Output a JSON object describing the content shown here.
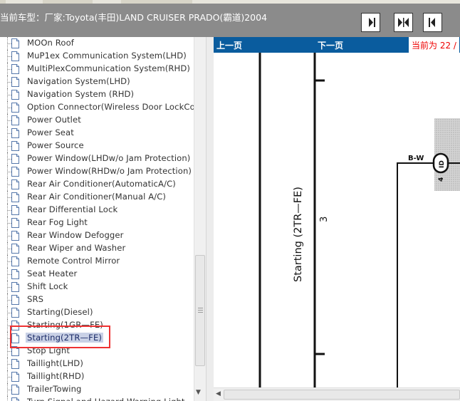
{
  "header": {
    "title": "当前车型：厂家:Toyota(丰田)LAND CRUISER PRADO(霸道)2004"
  },
  "nav_buttons": [
    {
      "name": "first-page",
      "icon": "skip-to-end-icon"
    },
    {
      "name": "dual-page",
      "icon": "two-page-icon"
    },
    {
      "name": "prev-page",
      "icon": "skip-back-icon"
    }
  ],
  "sidebar": {
    "items": [
      {
        "label": "MOOn Roof"
      },
      {
        "label": "MuP1ex Communication System(LHD)"
      },
      {
        "label": "MuItiPlexCommunication System(RHD)"
      },
      {
        "label": "Navigation System(LHD)"
      },
      {
        "label": "Navigation System (RHD)"
      },
      {
        "label": "Option Connector(Wireless Door LockCon"
      },
      {
        "label": "Power Outlet"
      },
      {
        "label": "Power Seat"
      },
      {
        "label": "Power Source"
      },
      {
        "label": "Power Window(LHDw/o Jam Protection)"
      },
      {
        "label": "Power Window(RHDw/o Jam Protection)"
      },
      {
        "label": "Rear Air Conditioner(AutomaticA/C)"
      },
      {
        "label": "Rear Air Conditioner(Manual A/C)"
      },
      {
        "label": "Rear DifferentiaI Lock"
      },
      {
        "label": "Rear Fog Light"
      },
      {
        "label": "Rear Window Defogger"
      },
      {
        "label": "Rear Wiper and Washer"
      },
      {
        "label": "Remote Control Mirror"
      },
      {
        "label": "Seat Heater"
      },
      {
        "label": "Shift Lock"
      },
      {
        "label": "SRS"
      },
      {
        "label": "Starting(Diesel)"
      },
      {
        "label": "Starting(1GR—FE)"
      },
      {
        "label": "Starting(2TR—FE)",
        "selected": true
      },
      {
        "label": "Stop Light"
      },
      {
        "label": "Taillight(LHD)"
      },
      {
        "label": "Taillight(RHD)"
      },
      {
        "label": "TrailerTowing"
      },
      {
        "label": "Turn Signal and Hazard Warning Light"
      }
    ]
  },
  "viewer": {
    "prev_label": "上一页",
    "next_label": "下一页",
    "status": "当前为 22 /"
  },
  "diagram": {
    "title": "Starting (2TR—FE)",
    "section_number": "3",
    "wire_label": "B-W",
    "connector_label": "ID",
    "connector_pin": "4"
  },
  "colors": {
    "header_bg": "#8b8b8b",
    "toolbar_bg": "#0a5c9e",
    "status_text": "#e00000",
    "highlight_box": "#e33333",
    "selected_bg": "#c9d1e6"
  }
}
